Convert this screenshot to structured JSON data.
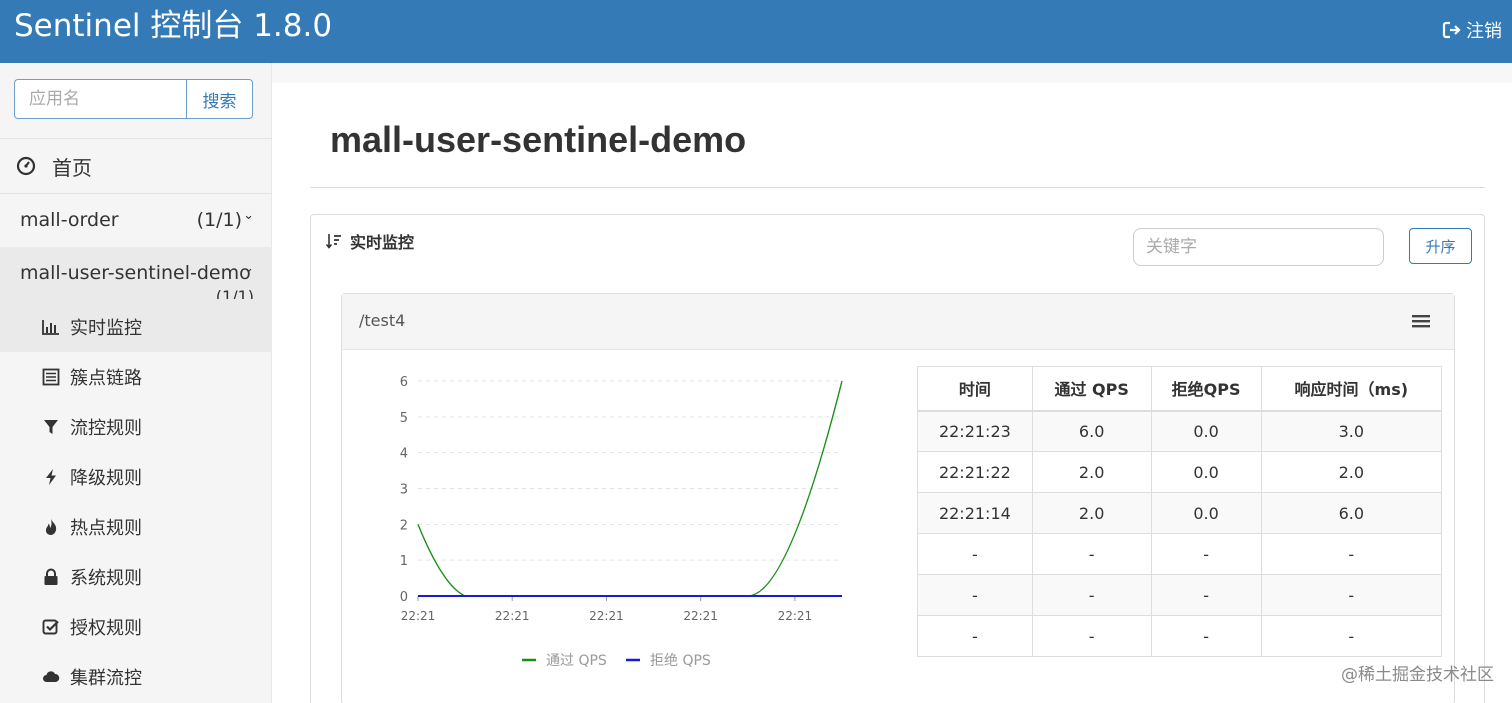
{
  "app": {
    "title": "Sentinel 控制台 1.8.0",
    "logout_label": "注销"
  },
  "sidebar": {
    "search": {
      "placeholder": "应用名",
      "button_label": "搜索"
    },
    "home_label": "首页",
    "apps": [
      {
        "name": "mall-order",
        "count": "(1/1)"
      },
      {
        "name": "mall-user-sentinel-demo",
        "count": "(1/1)"
      }
    ],
    "sub_items": [
      {
        "label": "实时监控",
        "icon": "bar-chart-icon"
      },
      {
        "label": "簇点链路",
        "icon": "list-icon"
      },
      {
        "label": "流控规则",
        "icon": "filter-icon"
      },
      {
        "label": "降级规则",
        "icon": "flash-icon"
      },
      {
        "label": "热点规则",
        "icon": "fire-icon"
      },
      {
        "label": "系统规则",
        "icon": "lock-icon"
      },
      {
        "label": "授权规则",
        "icon": "check-icon"
      },
      {
        "label": "集群流控",
        "icon": "cloud-icon"
      }
    ]
  },
  "main": {
    "page_title": "mall-user-sentinel-demo",
    "panel_title": "实时监控",
    "keyword_placeholder": "关键字",
    "sort_button": "升序",
    "resource": {
      "name": "/test4",
      "table": {
        "headers": [
          "时间",
          "通过 QPS",
          "拒绝QPS",
          "响应时间（ms)"
        ],
        "rows": [
          [
            "22:21:23",
            "6.0",
            "0.0",
            "3.0"
          ],
          [
            "22:21:22",
            "2.0",
            "0.0",
            "2.0"
          ],
          [
            "22:21:14",
            "2.0",
            "0.0",
            "6.0"
          ],
          [
            "-",
            "-",
            "-",
            "-"
          ],
          [
            "-",
            "-",
            "-",
            "-"
          ],
          [
            "-",
            "-",
            "-",
            "-"
          ]
        ]
      }
    }
  },
  "chart_data": {
    "type": "line",
    "x": [
      "22:21",
      "22:21",
      "22:21",
      "22:21",
      "22:21"
    ],
    "ylim": [
      0,
      6
    ],
    "yticks": [
      0,
      1,
      2,
      3,
      4,
      5,
      6
    ],
    "series": [
      {
        "name": "通过 QPS",
        "color": "#1a8f1a",
        "points": [
          [
            0,
            2
          ],
          [
            0.5,
            0
          ],
          [
            3.5,
            0
          ],
          [
            4.5,
            6
          ]
        ]
      },
      {
        "name": "拒绝 QPS",
        "color": "#1a1adb",
        "points": [
          [
            0,
            0
          ],
          [
            4.5,
            0
          ]
        ]
      }
    ],
    "legend": "bottom",
    "grid": true
  },
  "watermark": "@稀土掘金技术社区",
  "colors": {
    "header": "#337ab7",
    "pass": "#1a8f1a",
    "block": "#1a1adb"
  }
}
